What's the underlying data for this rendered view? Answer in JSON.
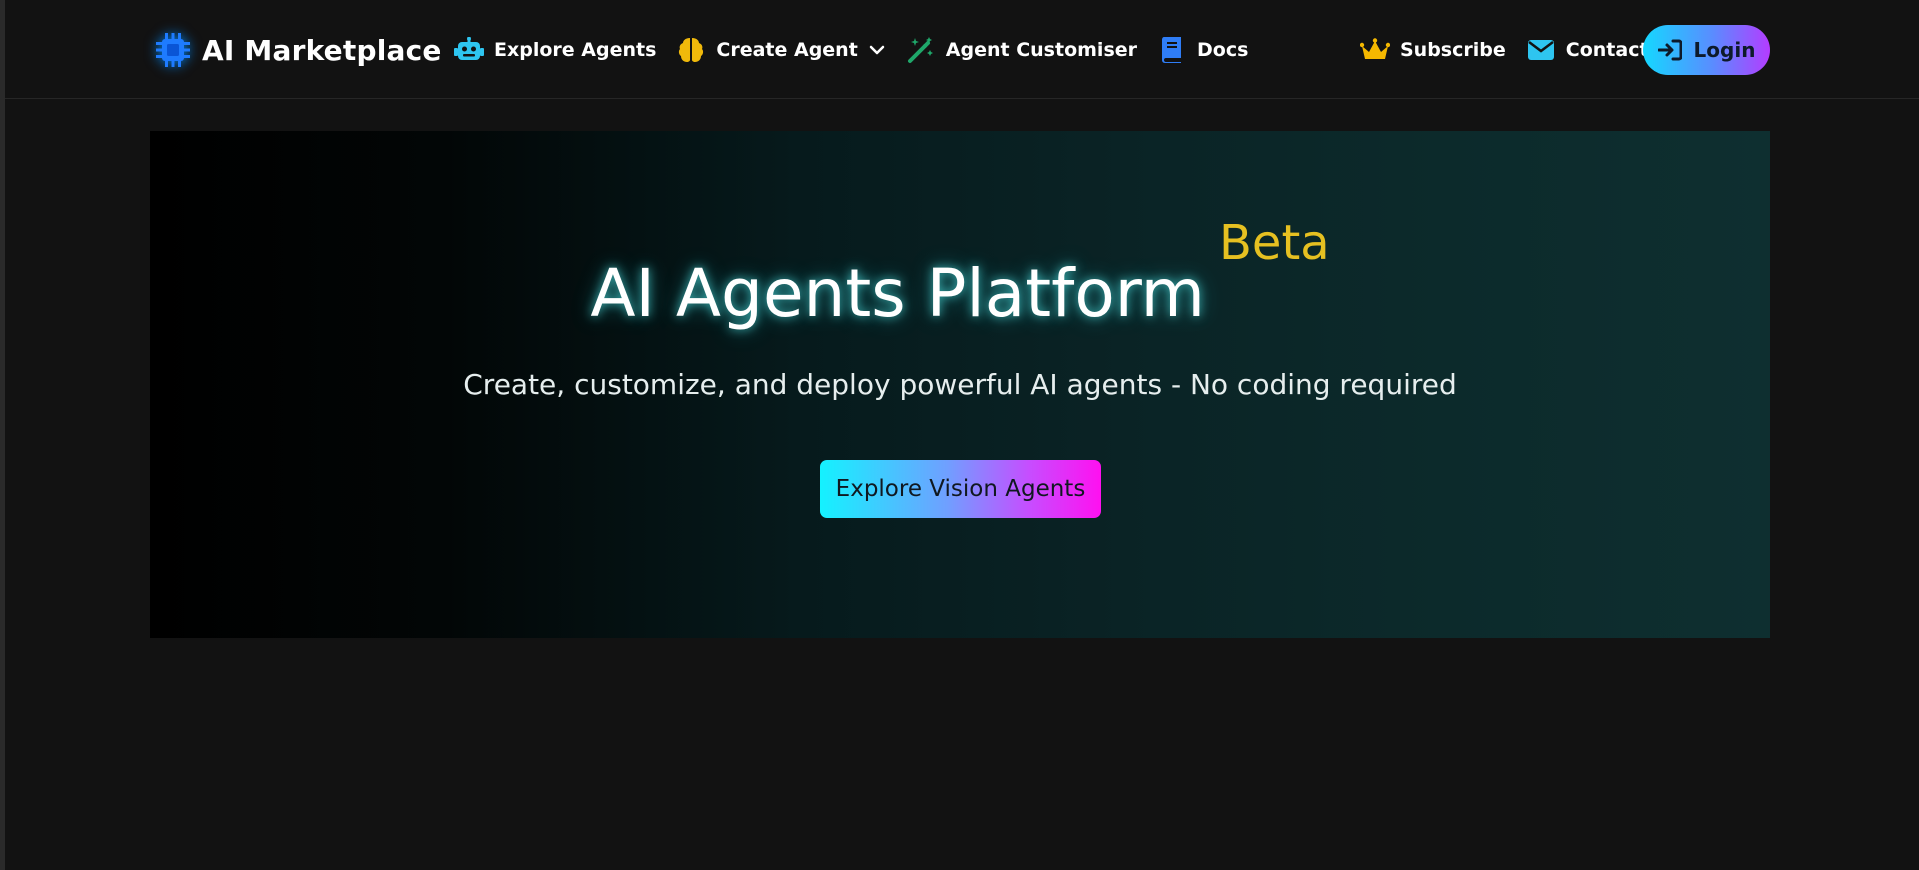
{
  "navbar": {
    "brand": {
      "icon": "chip-icon",
      "label": "AI Marketplace"
    },
    "links": [
      {
        "icon": "robot-icon",
        "label": "Explore Agents",
        "color": "#2ec5f0"
      },
      {
        "icon": "brain-icon",
        "label": "Create Agent",
        "color": "#f0b90b",
        "has_dropdown": true
      },
      {
        "icon": "magic-wand-icon",
        "label": "Agent Customiser",
        "color": "#1fa76a"
      },
      {
        "icon": "book-icon",
        "label": "Docs",
        "color": "#2f7df6"
      }
    ],
    "right_links": [
      {
        "icon": "crown-icon",
        "label": "Subscribe",
        "color": "#f5b800"
      },
      {
        "icon": "envelope-icon",
        "label": "Contact",
        "color": "#2ec5f0"
      }
    ],
    "login": {
      "icon": "sign-in-icon",
      "label": "Login"
    }
  },
  "hero": {
    "title": "AI Agents Platform",
    "badge": "Beta",
    "subtitle": "Create, customize, and deploy powerful AI agents - No coding required",
    "cta_label": "Explore Vision Agents"
  },
  "colors": {
    "background": "#121212",
    "beta": "#e6c021",
    "accent_cyan": "#14f2ff",
    "accent_magenta": "#ff10f0"
  }
}
